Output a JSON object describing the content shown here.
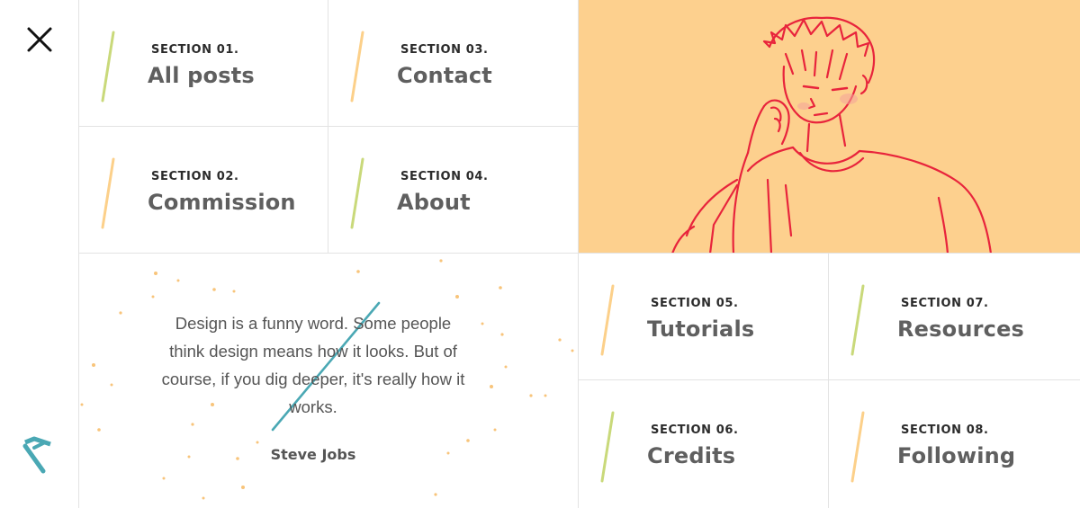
{
  "nav": {
    "close_icon": "close-icon",
    "logo_icon": "chevron-logo-icon"
  },
  "sections": [
    {
      "kicker": "SECTION 01.",
      "title": "All posts",
      "accent": "#c9d97a"
    },
    {
      "kicker": "SECTION 03.",
      "title": "Contact",
      "accent": "#fcd08a"
    },
    {
      "kicker": "SECTION 02.",
      "title": "Commission",
      "accent": "#fcd08a"
    },
    {
      "kicker": "SECTION 04.",
      "title": "About",
      "accent": "#c9d97a"
    },
    {
      "kicker": "SECTION 05.",
      "title": "Tutorials",
      "accent": "#fcd08a"
    },
    {
      "kicker": "SECTION 07.",
      "title": "Resources",
      "accent": "#c9d97a"
    },
    {
      "kicker": "SECTION 06.",
      "title": "Credits",
      "accent": "#c9d97a"
    },
    {
      "kicker": "SECTION 08.",
      "title": "Following",
      "accent": "#fcd08a"
    }
  ],
  "quote": {
    "text": "Design is a funny word. Some people think design means how it looks. But of course, if you dig deeper, it's really how it works.",
    "author": "Steve Jobs"
  },
  "colors": {
    "illustration_bg": "#fdd08e",
    "sketch_stroke": "#e8243c",
    "teal_accent": "#4aa8b4",
    "dot_color": "#f8c47a",
    "border": "#e3e3e3"
  }
}
